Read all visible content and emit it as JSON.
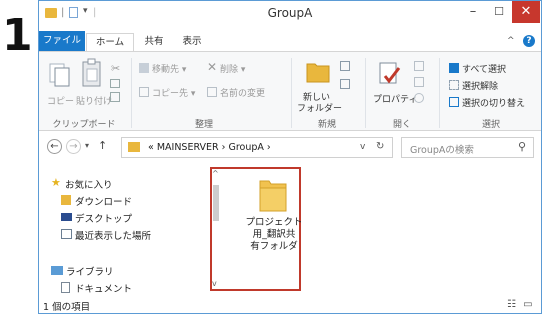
{
  "step_number": "1",
  "window": {
    "title": "GroupA",
    "minimize_glyph": "–",
    "maximize_glyph": "☐",
    "close_glyph": "✕",
    "quick_access_sep": "|",
    "quick_access_arrow": "▾"
  },
  "tabs": {
    "file": "ファイル",
    "home": "ホーム",
    "share": "共有",
    "view": "表示",
    "collapse": "^",
    "help": "?"
  },
  "ribbon": {
    "clipboard": {
      "copy": "コピー",
      "paste": "貼り付け",
      "label": "クリップボード"
    },
    "organize": {
      "move_to": "移動先 ▾",
      "delete": "削除 ▾",
      "copy_to": "コピー先 ▾",
      "rename": "名前の変更",
      "label": "整理"
    },
    "new": {
      "new_folder_line1": "新しい",
      "new_folder_line2": "フォルダー",
      "label": "新規"
    },
    "open": {
      "properties": "プロパティ",
      "label": "開く"
    },
    "select": {
      "select_all": "すべて選択",
      "select_none": "選択解除",
      "invert": "選択の切り替え",
      "label": "選択"
    }
  },
  "address": {
    "back": "←",
    "forward": "→",
    "recent": "▾",
    "up": "↑",
    "path": "« MAINSERVER › GroupA ›",
    "dropdown": "v",
    "refresh": "↻",
    "search_placeholder": "GroupAの検索",
    "search_icon": "⚲"
  },
  "nav_pane": {
    "favorites": "お気に入り",
    "downloads": "ダウンロード",
    "desktop": "デスクトップ",
    "recent_places": "最近表示した場所",
    "libraries": "ライブラリ",
    "documents": "ドキュメント",
    "scroll_up": "^",
    "scroll_down": "v"
  },
  "files": [
    {
      "line1": "プロジェクト",
      "line2": "用_翻訳共",
      "line3": "有フォルダ"
    }
  ],
  "status": {
    "item_count": "1 個の項目"
  },
  "colors": {
    "accent": "#1979ca",
    "close": "#c7372d",
    "highlight": "#c0392b",
    "folder": "#e9b73d"
  }
}
